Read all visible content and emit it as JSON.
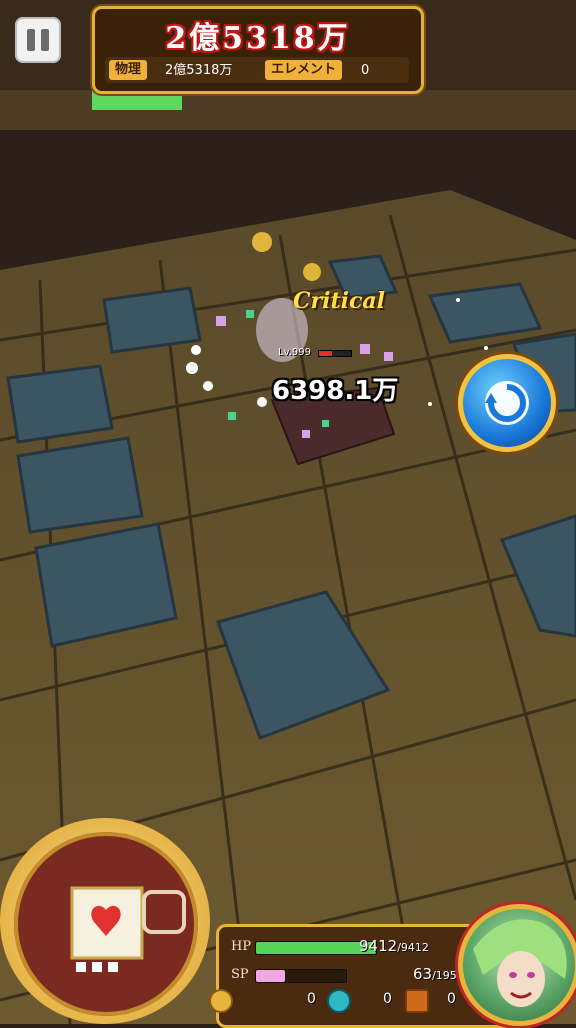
{
  "hud": {
    "pause_icon": "pause-icon",
    "total_damage": "2億5318万",
    "physical_label": "物理",
    "physical_value": "2億5318万",
    "element_label": "エレメント",
    "element_value": "0"
  },
  "battle": {
    "critical_text": "Critical",
    "enemy_level": "Lv.999",
    "enemy_hp_fraction": 0.4,
    "damage_popup": "6398.1万"
  },
  "controls": {
    "rotate_icon": "rotate-icon",
    "ability_icon": "ability-card-icon"
  },
  "status": {
    "hp_label": "HP",
    "hp_current": "9412",
    "hp_max": "/9412",
    "hp_fraction": 1.0,
    "sp_label": "SP",
    "sp_current": "63",
    "sp_max": "/195",
    "sp_fraction": 0.32,
    "coin_count": "0",
    "gem_count": "0",
    "chest_count": "0"
  },
  "colors": {
    "gold_border": "#e7b43c",
    "hp_bar": "#58d35a",
    "sp_bar": "#f3a8e6",
    "critical": "#ffe04a",
    "total_damage_outline": "#c21414"
  }
}
